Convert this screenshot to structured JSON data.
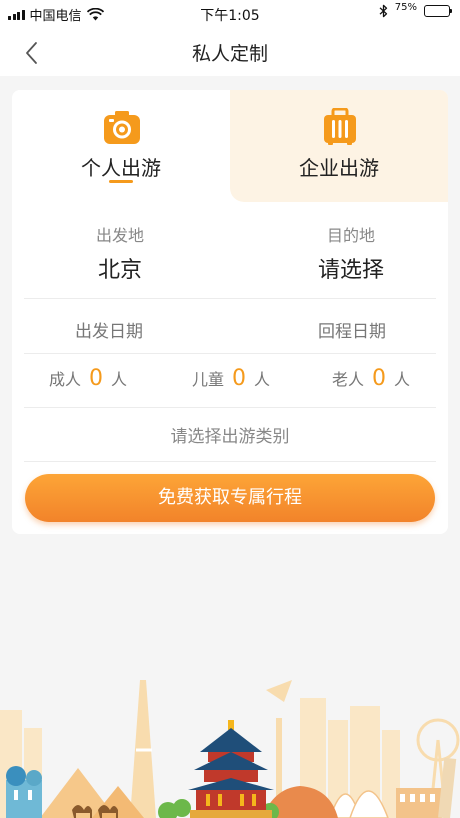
{
  "status_bar": {
    "carrier": "中国电信",
    "time": "下午1:05",
    "battery_percent": "75%",
    "battery_level": 0.75
  },
  "nav": {
    "title": "私人定制"
  },
  "tabs": [
    {
      "label": "个人出游",
      "icon": "camera-icon",
      "selected": true
    },
    {
      "label": "企业出游",
      "icon": "suitcase-icon",
      "selected": false
    }
  ],
  "form": {
    "departure_caption": "出发地",
    "departure_value": "北京",
    "destination_caption": "目的地",
    "destination_value": "请选择",
    "depart_date": "出发日期",
    "return_date": "回程日期",
    "adults_label": "成人",
    "adults_count": "0",
    "children_label": "儿童",
    "children_count": "0",
    "seniors_label": "老人",
    "seniors_count": "0",
    "unit": "人",
    "category_placeholder": "请选择出游类别"
  },
  "cta": {
    "label": "免费获取专属行程"
  },
  "colors": {
    "accent": "#f59a1c",
    "business_tab_bg": "#fdf3e4",
    "cta_start": "#fda537",
    "cta_end": "#f2832a"
  }
}
